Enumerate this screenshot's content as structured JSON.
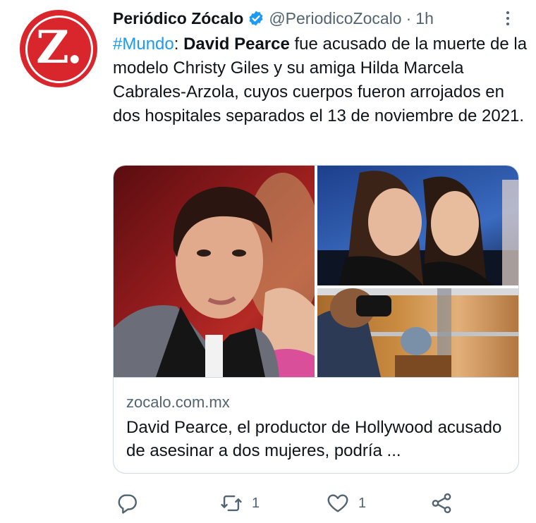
{
  "tweet": {
    "author_name": "Periódico Zócalo",
    "handle": "@PeriodicoZocalo",
    "separator": "·",
    "time": "1h",
    "avatar_letter": "Z.",
    "hashtag": "#Mundo",
    "colon": ":",
    "bold_name": "David Pearce",
    "body": " fue acusado de la muerte de la modelo Christy Giles y su amiga Hilda Marcela Cabrales-Arzola, cuyos cuerpos fueron arrojados en dos hospitales separados el 13 de noviembre de 2021."
  },
  "card": {
    "domain": "zocalo.com.mx",
    "title": "David Pearce, el productor de Hollywood acusado de asesinar a dos mujeres, podría ..."
  },
  "actions": {
    "reply_icon": "reply-icon",
    "retweet_icon": "retweet-icon",
    "retweet_count": "1",
    "like_icon": "heart-icon",
    "like_count": "1",
    "share_icon": "share-icon"
  },
  "colors": {
    "brand_red": "#d9262d",
    "link_blue": "#1d9bf0",
    "secondary_text": "#536471",
    "primary_text": "#0f1419",
    "border": "#cfd9de"
  }
}
